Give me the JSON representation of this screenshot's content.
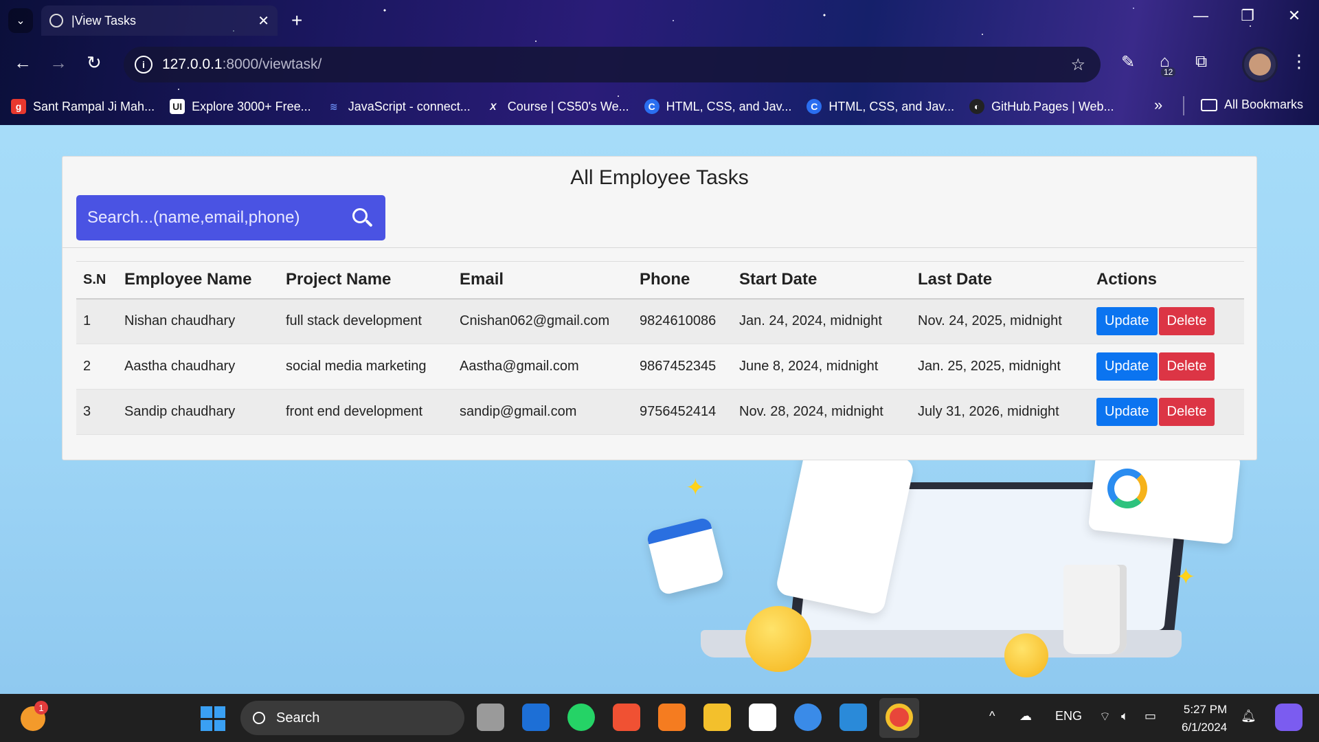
{
  "browser": {
    "tab_title": "|View Tasks",
    "url_host": "127.0.0.1",
    "url_path": ":8000/viewtask/",
    "extension_badge": "12",
    "bookmarks": [
      {
        "label": "Sant Rampal Ji Mah...",
        "fav": "g",
        "color": "#e8382e"
      },
      {
        "label": "Explore 3000+ Free...",
        "fav": "UI",
        "color": "#222222"
      },
      {
        "label": "JavaScript - connect...",
        "fav": "≋",
        "color": "#2a4aa0"
      },
      {
        "label": "Course | CS50's We...",
        "fav": "X",
        "color": "#111111"
      },
      {
        "label": "HTML, CSS, and Jav...",
        "fav": "C",
        "color": "#2a6ef0"
      },
      {
        "label": "HTML, CSS, and Jav...",
        "fav": "C",
        "color": "#2a6ef0"
      },
      {
        "label": "GitHub Pages | Web...",
        "fav": "◐",
        "color": "#222222"
      }
    ],
    "all_bookmarks": "All Bookmarks"
  },
  "page": {
    "title": "All Employee Tasks",
    "search_placeholder": "Search...(name,email,phone)",
    "columns": {
      "sn": "S.N",
      "employee": "Employee Name",
      "project": "Project Name",
      "email": "Email",
      "phone": "Phone",
      "start": "Start Date",
      "last": "Last Date",
      "actions": "Actions"
    },
    "update_label": "Update",
    "delete_label": "Delete",
    "rows": [
      {
        "sn": "1",
        "employee": "Nishan chaudhary",
        "project": "full stack development",
        "email": "Cnishan062@gmail.com",
        "phone": "9824610086",
        "start": "Jan. 24, 2024, midnight",
        "last": "Nov. 24, 2025, midnight"
      },
      {
        "sn": "2",
        "employee": "Aastha chaudhary",
        "project": "social media marketing",
        "email": "Aastha@gmail.com",
        "phone": "9867452345",
        "start": "June 8, 2024, midnight",
        "last": "Jan. 25, 2025, midnight"
      },
      {
        "sn": "3",
        "employee": "Sandip chaudhary",
        "project": "front end development",
        "email": "sandip@gmail.com",
        "phone": "9756452414",
        "start": "Nov. 28, 2024, midnight",
        "last": "July 31, 2026, midnight"
      }
    ]
  },
  "taskbar": {
    "weather_badge": "1",
    "search_label": "Search",
    "lang": "ENG",
    "time": "5:27 PM",
    "date": "6/1/2024"
  },
  "colors": {
    "search_bg": "#4a53e3",
    "update": "#0b74f0",
    "delete": "#dc3545",
    "page_bg": "#a6dcf9"
  }
}
